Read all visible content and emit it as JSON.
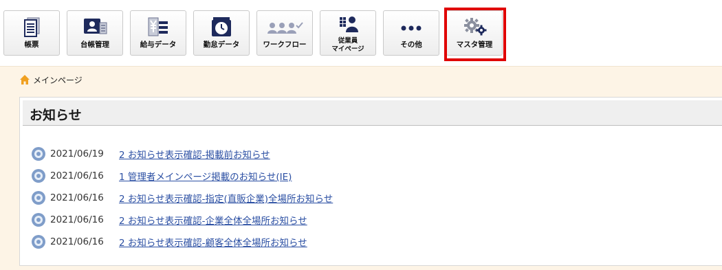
{
  "toolbar": {
    "buttons": [
      {
        "label": "帳票",
        "icon": "document-stack-icon"
      },
      {
        "label": "台帳管理",
        "icon": "employee-ledger-icon"
      },
      {
        "label": "給与データ",
        "icon": "payroll-data-icon"
      },
      {
        "label": "勤怠データ",
        "icon": "attendance-clock-icon"
      },
      {
        "label": "ワークフロー",
        "icon": "workflow-people-icon"
      },
      {
        "label_line1": "従業員",
        "label_line2": "マイページ",
        "icon": "employee-mypage-icon"
      },
      {
        "label": "その他",
        "icon": "more-dots-icon"
      },
      {
        "label": "マスタ管理",
        "icon": "gear-icon"
      }
    ],
    "highlight_color": "#e00000"
  },
  "breadcrumb": {
    "label": "メインページ",
    "icon": "home-icon"
  },
  "news": {
    "title": "お知らせ",
    "items": [
      {
        "date": "2021/06/19",
        "text": "2 お知らせ表示確認-掲載前お知らせ"
      },
      {
        "date": "2021/06/16",
        "text": "1 管理者メインページ掲載のお知らせ(IE)"
      },
      {
        "date": "2021/06/16",
        "text": "2 お知らせ表示確認-指定(直販企業)全場所お知らせ"
      },
      {
        "date": "2021/06/16",
        "text": "2 お知らせ表示確認-企業全体全場所お知らせ"
      },
      {
        "date": "2021/06/16",
        "text": "2 お知らせ表示確認-顧客全体全場所お知らせ"
      }
    ]
  },
  "colors": {
    "content_bg": "#fdf4e6",
    "link": "#2b4fa3",
    "icon_navy": "#1e2a5c"
  }
}
